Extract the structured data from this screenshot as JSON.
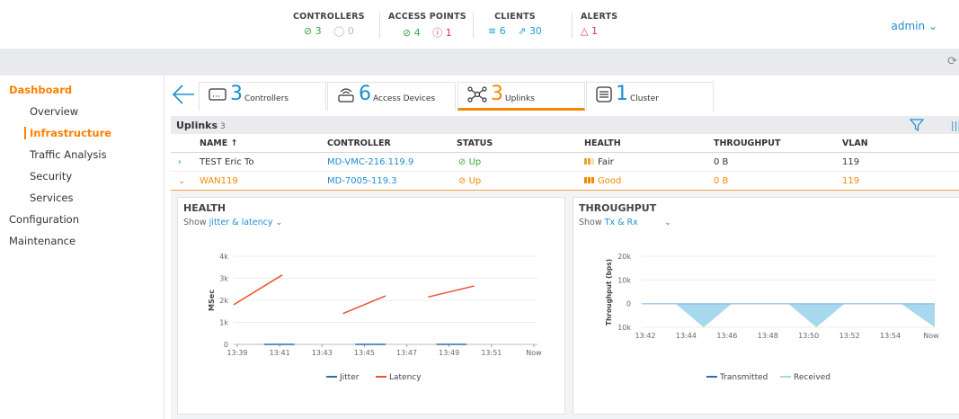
{
  "header": {
    "controllers": {
      "title": "CONTROLLERS",
      "ok": "3",
      "off": "0"
    },
    "access_points": {
      "title": "ACCESS POINTS",
      "ok": "4",
      "err": "1"
    },
    "clients": {
      "title": "CLIENTS",
      "wifi": "6",
      "wired": "30"
    },
    "alerts": {
      "title": "ALERTS",
      "count": "1"
    },
    "user": "admin"
  },
  "sidebar": {
    "dashboard": "Dashboard",
    "overview": "Overview",
    "infrastructure": "Infrastructure",
    "traffic": "Traffic Analysis",
    "security": "Security",
    "services": "Services",
    "configuration": "Configuration",
    "maintenance": "Maintenance"
  },
  "tabs": [
    {
      "count": "3",
      "label": "Controllers"
    },
    {
      "count": "6",
      "label": "Access Devices"
    },
    {
      "count": "3",
      "label": "Uplinks"
    },
    {
      "count": "1",
      "label": "Cluster"
    }
  ],
  "uplinks": {
    "title": "Uplinks",
    "count": "3",
    "columns": [
      "NAME",
      "CONTROLLER",
      "STATUS",
      "HEALTH",
      "THROUGHPUT",
      "VLAN"
    ],
    "rows": [
      {
        "name": "TEST Eric To",
        "controller": "MD-VMC-216.119.9",
        "status": "Up",
        "health": "Fair",
        "throughput": "0 B",
        "vlan": "119"
      },
      {
        "name": "WAN119",
        "controller": "MD-7005-119.3",
        "status": "Up",
        "health": "Good",
        "throughput": "0 B",
        "vlan": "119"
      }
    ]
  },
  "health_card": {
    "title": "HEALTH",
    "show_label": "Show",
    "show_value": "jitter & latency"
  },
  "throughput_card": {
    "title": "THROUGHPUT",
    "show_label": "Show",
    "show_value": "Tx & Rx"
  },
  "chart_data": [
    {
      "type": "line",
      "ylabel": "MSec",
      "ylim": [
        0,
        4000
      ],
      "yticks": [
        "0",
        "1k",
        "2k",
        "3k",
        "4k"
      ],
      "xticks": [
        "13:39",
        "13:41",
        "13:43",
        "13:45",
        "13:47",
        "13:49",
        "13:51",
        "Now"
      ],
      "series": [
        {
          "name": "Jitter",
          "color": "#2c6fb0",
          "segments": [
            [
              [
                13.675,
                0
              ],
              [
                13.7,
                0
              ]
            ],
            [
              [
                13.75,
                0
              ],
              [
                13.775,
                0
              ]
            ],
            [
              [
                13.8167,
                0
              ],
              [
                13.8417,
                0
              ]
            ]
          ]
        },
        {
          "name": "Latency",
          "color": "#e8542a",
          "segments": [
            [
              [
                13.65,
                1800
              ],
              [
                13.69,
                3150
              ]
            ],
            [
              [
                13.74,
                1400
              ],
              [
                13.775,
                2200
              ]
            ],
            [
              [
                13.81,
                2150
              ],
              [
                13.848,
                2650
              ]
            ]
          ]
        }
      ]
    },
    {
      "type": "area",
      "ylabel": "Throughput (bps)",
      "ylim": [
        -10000,
        20000
      ],
      "yticks": [
        "10k",
        "0",
        "10k",
        "20k"
      ],
      "xticks": [
        "13:42",
        "13:44",
        "13:46",
        "13:48",
        "13:50",
        "13:52",
        "13:54",
        "Now"
      ],
      "series": [
        {
          "name": "Transmitted",
          "color": "#2c6fb0",
          "values": [
            0,
            0,
            0,
            0,
            0,
            0,
            0,
            0
          ]
        },
        {
          "name": "Received",
          "color": "#a8d8ee",
          "triangles": [
            [
              13.73,
              13.78
            ],
            [
              13.83,
              13.88
            ],
            [
              13.93,
              13.96
            ]
          ],
          "depth": -10000
        }
      ]
    }
  ]
}
